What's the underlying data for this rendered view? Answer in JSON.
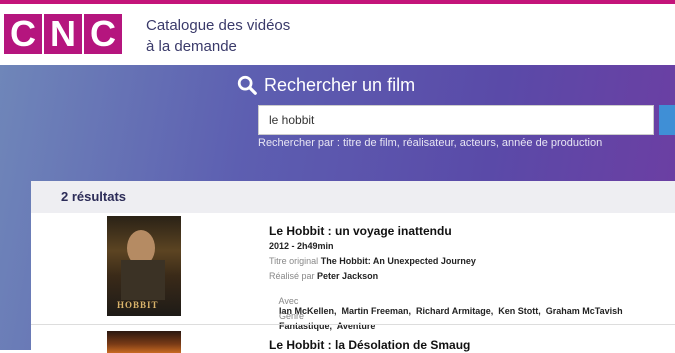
{
  "header": {
    "logo_letters": [
      "C",
      "N",
      "C"
    ],
    "title_line1": "Catalogue des vidéos",
    "title_line2": "à la demande"
  },
  "search": {
    "heading": "Rechercher un film",
    "value": "le hobbit",
    "hint": "Rechercher par : titre de film, réalisateur, acteurs, année de production"
  },
  "results": {
    "count_label": "2 résultats",
    "items": [
      {
        "title": "Le Hobbit : un voyage inattendu",
        "year_duration": "2012 - 2h49min",
        "original_title_label": "Titre original",
        "original_title": "The Hobbit: An Unexpected Journey",
        "director_label": "Réalisé par",
        "director": "Peter Jackson",
        "cast_label": "Avec",
        "cast": "Ian McKellen,  Martin Freeman,  Richard Armitage,  Ken Stott,  Graham McTavish",
        "genre_label": "Genre",
        "genre": "Fantastique,  Aventure",
        "poster_text": "HOBBIT"
      },
      {
        "title": "Le Hobbit : la Désolation de Smaug"
      }
    ]
  },
  "colors": {
    "brand": "#b5157e",
    "accent": "#3f8fd6"
  }
}
